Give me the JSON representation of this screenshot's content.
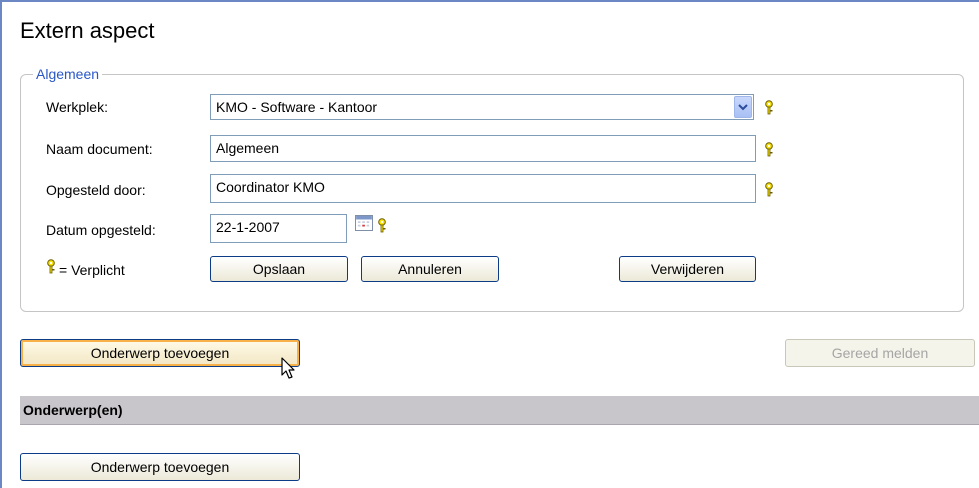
{
  "page": {
    "title": "Extern aspect"
  },
  "group": {
    "legend": "Algemeen"
  },
  "fields": {
    "werkplek": {
      "label": "Werkplek:",
      "value": "KMO - Software - Kantoor"
    },
    "naam": {
      "label": "Naam document:",
      "value": "Algemeen"
    },
    "opgesteld": {
      "label": "Opgesteld door:",
      "value": "Coordinator KMO"
    },
    "datum": {
      "label": "Datum opgesteld:",
      "value": "22-1-2007"
    }
  },
  "legend_note": "= Verplicht",
  "buttons": {
    "opslaan": "Opslaan",
    "annuleren": "Annuleren",
    "verwijderen": "Verwijderen",
    "onderwerp_toevoegen": "Onderwerp toevoegen",
    "gereed_melden": "Gereed melden",
    "onderwerp_toevoegen_2": "Onderwerp toevoegen"
  },
  "section": {
    "title": "Onderwerp(en)"
  },
  "icons": {
    "required": "key-icon",
    "calendar": "calendar-icon",
    "dropdown": "chevron-down-icon",
    "cursor": "mouse-pointer-icon"
  },
  "colors": {
    "frame": "#6b87c4",
    "legend": "#2a57c7",
    "key": "#e8d200",
    "section_bar": "#c8c6cb",
    "focus": "#f8b048"
  }
}
